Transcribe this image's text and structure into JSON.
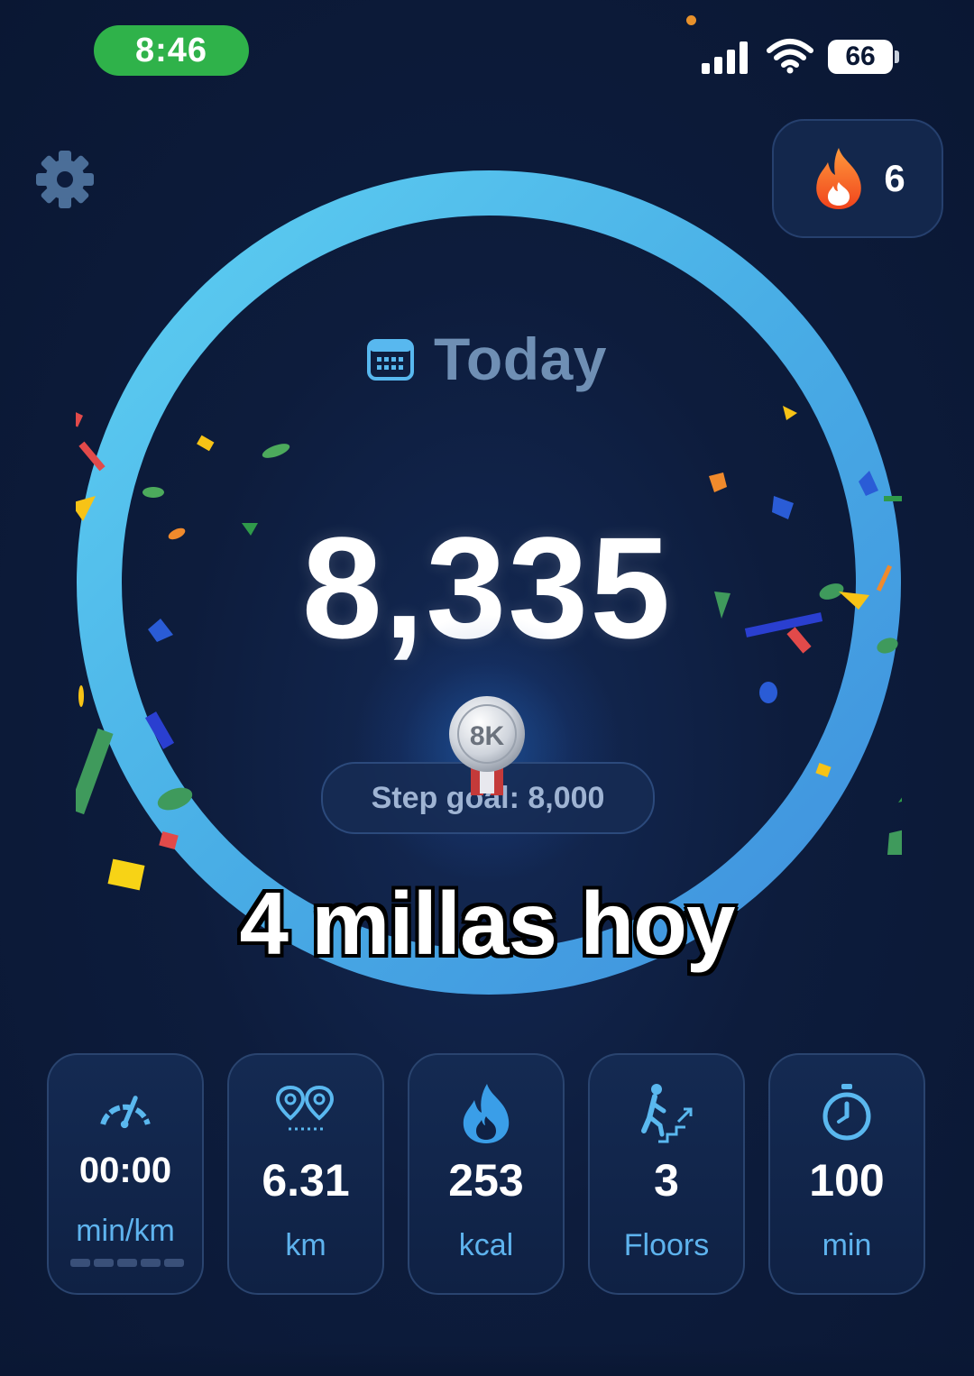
{
  "status_bar": {
    "time": "8:46",
    "battery": "66"
  },
  "streak": {
    "count": "6",
    "icon": "flame-icon"
  },
  "progress": {
    "label": "Today",
    "steps": "8,335",
    "goal_text": "Step goal: 8,000",
    "badge": "8K",
    "fraction": 1.0
  },
  "caption": "4 millas hoy",
  "stats": [
    {
      "value": "00:00",
      "unit": "min/km",
      "icon": "speedometer-icon"
    },
    {
      "value": "6.31",
      "unit": "km",
      "icon": "route-pins-icon"
    },
    {
      "value": "253",
      "unit": "kcal",
      "icon": "flame-icon"
    },
    {
      "value": "3",
      "unit": "Floors",
      "icon": "stairs-icon"
    },
    {
      "value": "100",
      "unit": "min",
      "icon": "stopwatch-icon"
    }
  ],
  "colors": {
    "ring": "#4cb4ec",
    "accent": "#5eb3ee",
    "time_pill": "#2fb24a",
    "background": "#0d1c3c"
  }
}
